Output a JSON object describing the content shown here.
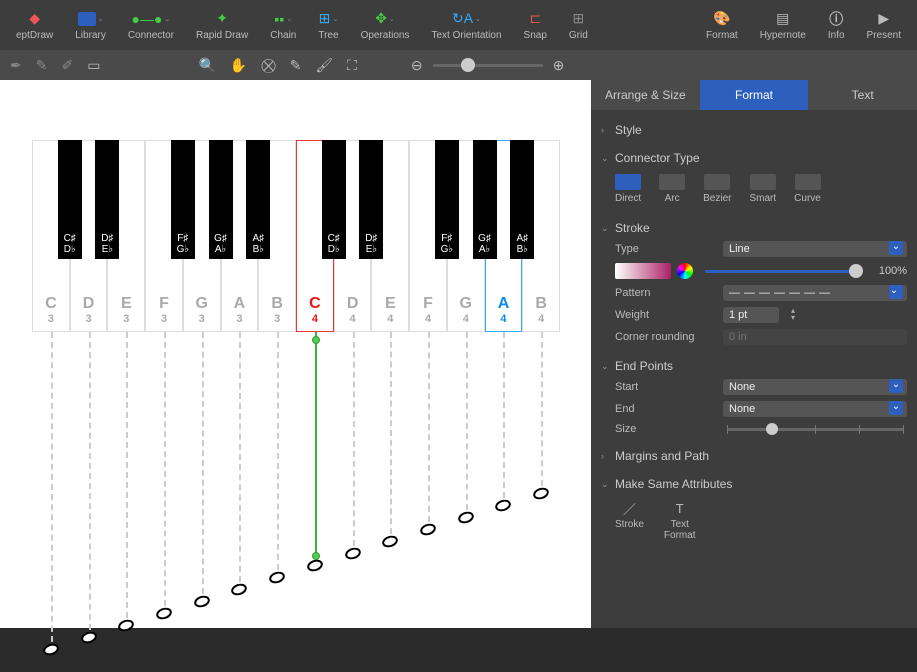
{
  "toolbar": {
    "items": [
      {
        "label": "eptDraw"
      },
      {
        "label": "Library"
      },
      {
        "label": "Connector"
      },
      {
        "label": "Rapid Draw"
      },
      {
        "label": "Chain"
      },
      {
        "label": "Tree"
      },
      {
        "label": "Operations"
      },
      {
        "label": "Text Orientation"
      },
      {
        "label": "Snap"
      },
      {
        "label": "Grid"
      }
    ],
    "right": [
      {
        "label": "Format"
      },
      {
        "label": "Hypernote"
      },
      {
        "label": "Info"
      },
      {
        "label": "Present"
      }
    ]
  },
  "piano": {
    "white": [
      {
        "n": "C",
        "o": "3"
      },
      {
        "n": "D",
        "o": "3"
      },
      {
        "n": "E",
        "o": "3"
      },
      {
        "n": "F",
        "o": "3"
      },
      {
        "n": "G",
        "o": "3"
      },
      {
        "n": "A",
        "o": "3"
      },
      {
        "n": "B",
        "o": "3"
      },
      {
        "n": "C",
        "o": "4",
        "hl": "red"
      },
      {
        "n": "D",
        "o": "4"
      },
      {
        "n": "E",
        "o": "4"
      },
      {
        "n": "F",
        "o": "4"
      },
      {
        "n": "G",
        "o": "4"
      },
      {
        "n": "A",
        "o": "4",
        "hl": "blue"
      },
      {
        "n": "B",
        "o": "4"
      }
    ],
    "black": [
      {
        "sharp": "C♯",
        "flat": "D♭"
      },
      {
        "sharp": "D♯",
        "flat": "E♭"
      },
      {
        "sharp": "F♯",
        "flat": "G♭"
      },
      {
        "sharp": "G♯",
        "flat": "A♭"
      },
      {
        "sharp": "A♯",
        "flat": "B♭"
      },
      {
        "sharp": "C♯",
        "flat": "D♭"
      },
      {
        "sharp": "D♯",
        "flat": "E♭"
      },
      {
        "sharp": "F♯",
        "flat": "G♭"
      },
      {
        "sharp": "G♯",
        "flat": "A♭"
      },
      {
        "sharp": "A♯",
        "flat": "B♭"
      }
    ]
  },
  "panel": {
    "tabs": {
      "arrange": "Arrange & Size",
      "format": "Format",
      "text": "Text"
    },
    "style": "Style",
    "connector_type": {
      "title": "Connector Type",
      "opts": [
        "Direct",
        "Arc",
        "Bezier",
        "Smart",
        "Curve"
      ],
      "active": 0
    },
    "stroke": {
      "title": "Stroke",
      "type_label": "Type",
      "type_value": "Line",
      "opacity": "100%",
      "pattern_label": "Pattern",
      "weight_label": "Weight",
      "weight_value": "1 pt",
      "corner_label": "Corner rounding",
      "corner_value": "0 in"
    },
    "endpoints": {
      "title": "End Points",
      "start_label": "Start",
      "start_value": "None",
      "end_label": "End",
      "end_value": "None",
      "size_label": "Size"
    },
    "margins": "Margins and Path",
    "msa": {
      "title": "Make Same Attributes",
      "stroke": "Stroke",
      "text": "Text\nFormat"
    }
  }
}
